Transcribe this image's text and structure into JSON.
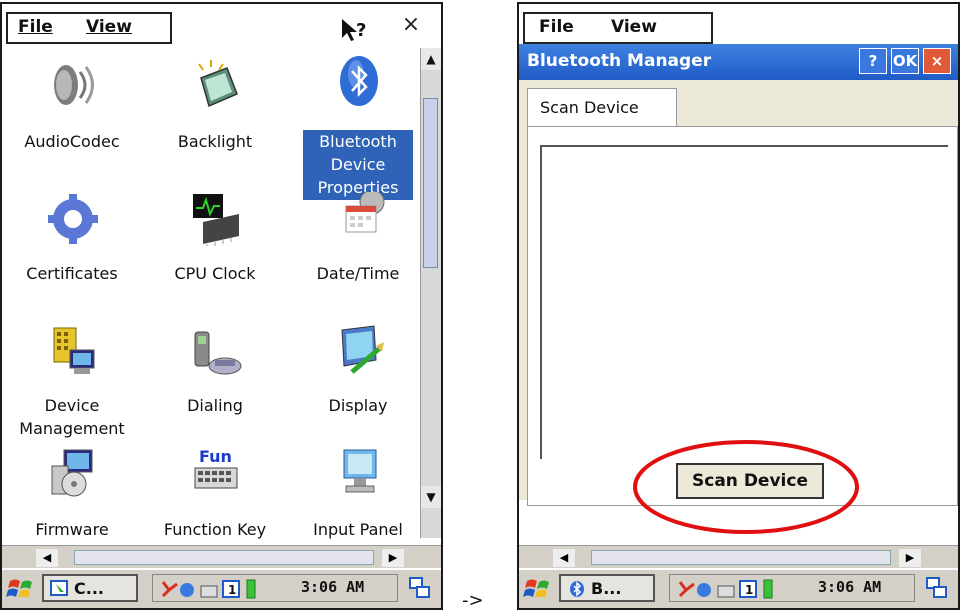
{
  "arrow": "->",
  "left": {
    "menu": {
      "file": "File",
      "view": "View"
    },
    "help": "?",
    "close": "×",
    "icons": [
      {
        "label": "AudioCodec"
      },
      {
        "label": "Backlight"
      },
      {
        "label": "Bluetooth Device Properties",
        "lines": [
          "Bluetooth",
          "Device",
          "Properties"
        ]
      },
      {
        "label": "Certificates"
      },
      {
        "label": "CPU Clock"
      },
      {
        "label": "Date/Time"
      },
      {
        "label": "Device Management",
        "lines": [
          "Device",
          "Management"
        ]
      },
      {
        "label": "Dialing"
      },
      {
        "label": "Display"
      },
      {
        "label": "Firmware"
      },
      {
        "label": "Function Key"
      },
      {
        "label": "Input Panel"
      }
    ],
    "taskbar": {
      "task": "C...",
      "clock": "3:06 AM",
      "tray_number": "1"
    }
  },
  "right": {
    "menu": {
      "file": "File",
      "view": "View"
    },
    "dialog_title": "Bluetooth Manager",
    "help_btn": "?",
    "ok_btn": "OK",
    "close_btn": "×",
    "tab": "Scan Device",
    "scan_button": "Scan Device",
    "taskbar": {
      "task": "B...",
      "clock": "3:06 AM",
      "tray_number": "1"
    }
  },
  "colors": {
    "selection": "#2e63b8",
    "title_bar": "#2a6ad6",
    "highlight_ring": "#e01010"
  }
}
